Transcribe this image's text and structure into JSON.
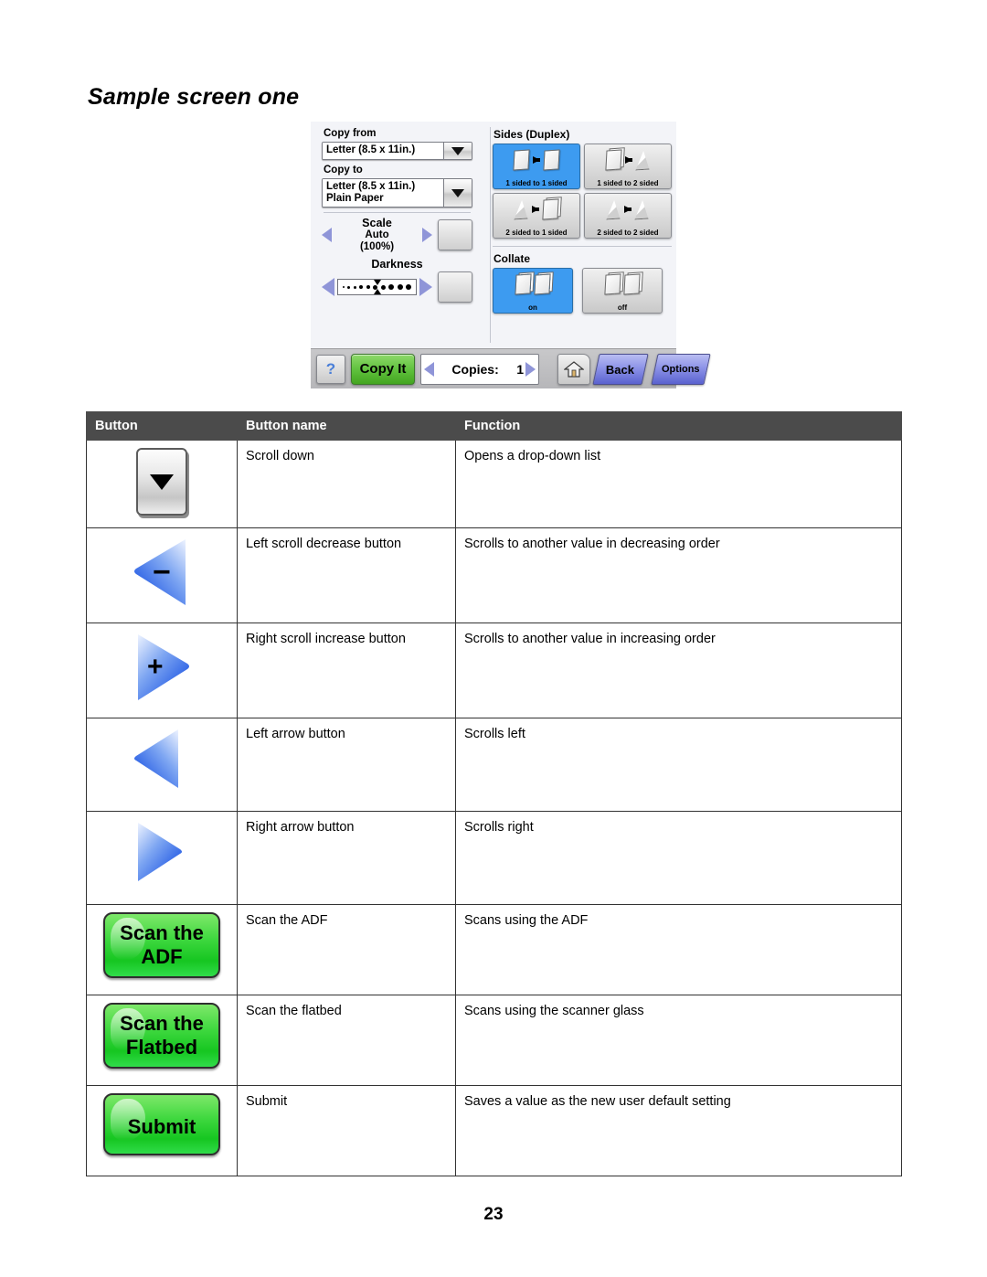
{
  "page": {
    "title": "Sample screen one",
    "page_number": "23"
  },
  "control_panel": {
    "copy_from": {
      "label": "Copy from",
      "value": "Letter (8.5 x 11in.)",
      "caret_icon": "chevron-down-icon"
    },
    "copy_to": {
      "label": "Copy to",
      "value_line1": "Letter (8.5 x 11in.)",
      "value_line2": "Plain Paper",
      "caret_icon": "chevron-down-icon"
    },
    "scale": {
      "label": "Scale",
      "value_line1": "Auto",
      "value_line2": "(100%)",
      "decrease_icon": "left-scroll-decrease-icon",
      "increase_icon": "right-scroll-increase-icon",
      "preview_icon": "content-preview-icon"
    },
    "darkness": {
      "label": "Darkness",
      "decrease_icon": "left-arrow-icon",
      "increase_icon": "right-arrow-icon",
      "preview_icon": "color-preview-icon"
    },
    "sides": {
      "label": "Sides (Duplex)",
      "options": [
        {
          "caption": "1 sided to 1 sided",
          "selected": true
        },
        {
          "caption": "1 sided to 2 sided",
          "selected": false
        },
        {
          "caption": "2 sided to 1 sided",
          "selected": false
        },
        {
          "caption": "2 sided to 2 sided",
          "selected": false
        }
      ]
    },
    "collate": {
      "label": "Collate",
      "options": [
        {
          "caption": "on",
          "selected": true
        },
        {
          "caption": "off",
          "selected": false
        }
      ]
    },
    "action_bar": {
      "help_label": "?",
      "copy_it_label": "Copy It",
      "copies_label": "Copies:",
      "copies_value": "1",
      "copies_decrease_icon": "left-scroll-decrease-icon",
      "copies_increase_icon": "right-scroll-increase-icon",
      "home_icon": "home-icon",
      "back_label": "Back",
      "options_label": "Options"
    }
  },
  "table": {
    "headers": {
      "button": "Button",
      "button_name": "Button name",
      "function": "Function"
    },
    "rows": [
      {
        "icon": "scroll-down-icon",
        "name": "Scroll down",
        "function": "Opens a drop-down list"
      },
      {
        "icon": "left-scroll-decrease-icon",
        "name": "Left scroll decrease button",
        "function": "Scrolls to another value in decreasing order"
      },
      {
        "icon": "right-scroll-increase-icon",
        "name": "Right scroll increase button",
        "function": "Scrolls to another value in increasing order"
      },
      {
        "icon": "left-arrow-icon",
        "name": "Left arrow button",
        "function": "Scrolls left"
      },
      {
        "icon": "right-arrow-icon",
        "name": "Right arrow button",
        "function": "Scrolls right"
      },
      {
        "icon": "scan-the-adf-button",
        "button_line1": "Scan the",
        "button_line2": "ADF",
        "name": "Scan the ADF",
        "function": "Scans using the ADF"
      },
      {
        "icon": "scan-the-flatbed-button",
        "button_line1": "Scan the",
        "button_line2": "Flatbed",
        "name": "Scan the flatbed",
        "function": "Scans using the scanner glass"
      },
      {
        "icon": "submit-button",
        "button_line1": "Submit",
        "button_line2": "",
        "name": "Submit",
        "function": "Saves a value as the new user default setting"
      }
    ]
  },
  "colors": {
    "header_bg": "#4b4b4b",
    "green_button": "#3fd83f",
    "blue_arrow": "#2a6ef0",
    "selected_tile": "#3d9bf0"
  }
}
